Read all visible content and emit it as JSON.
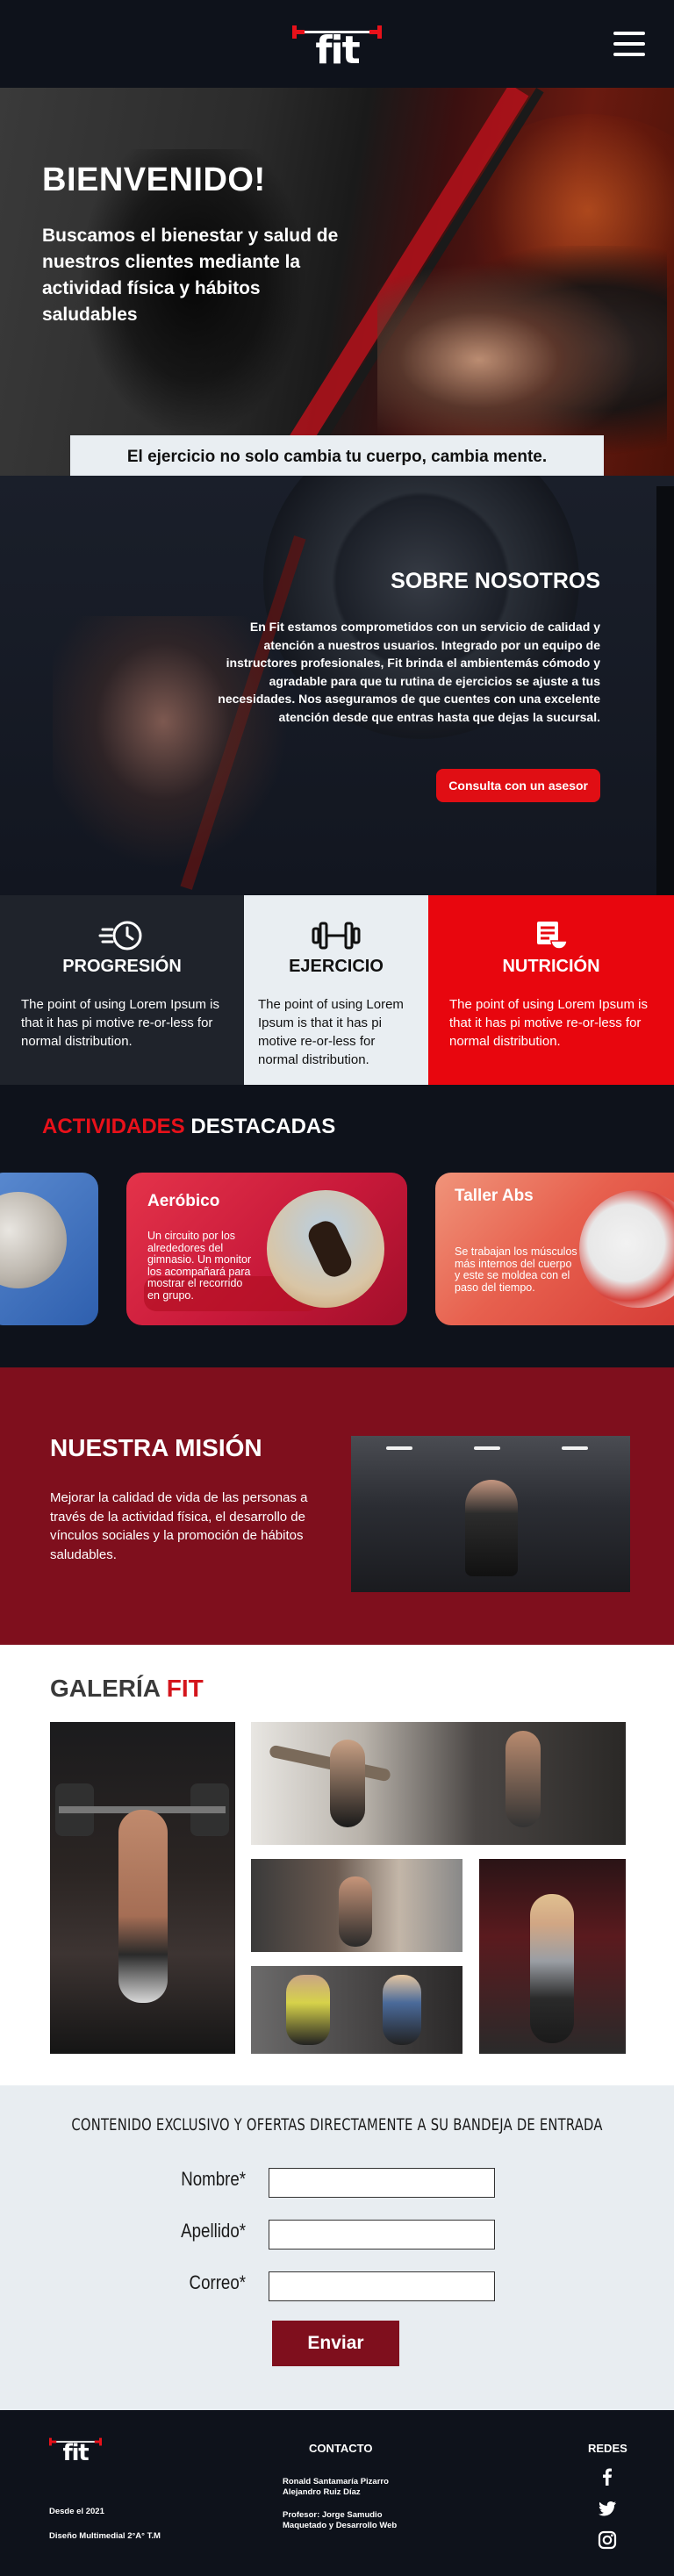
{
  "header": {
    "logo_text": "fit",
    "menu_icon": "hamburger-icon"
  },
  "hero": {
    "title": "BIENVENIDO!",
    "subtitle": "Buscamos el bienestar y salud de nuestros clientes mediante la actividad física y hábitos saludables",
    "banner": "El ejercicio no solo cambia tu cuerpo, cambia mente."
  },
  "about": {
    "title": "SOBRE NOSOTROS",
    "text": "En Fit estamos comprometidos con un servicio de calidad y atención a nuestros usuarios. Integrado por un equipo de instructores profesionales, Fit brinda el ambientemás cómodo y agradable para que tu rutina de ejercicios se ajuste a tus necesidades. Nos aseguramos de que cuentes con una excelente atención desde que entras hasta que dejas la sucursal.",
    "button": "Consulta con un asesor"
  },
  "features": [
    {
      "icon": "timer-icon",
      "title": "PROGRESIÓN",
      "text": "The point of using Lorem Ipsum is that it has pi motive re-or-less for normal distribution."
    },
    {
      "icon": "dumbbell-icon",
      "title": "EJERCICIO",
      "text": "The point of using Lorem Ipsum is that it has pi motive re-or-less for normal distribution."
    },
    {
      "icon": "nutrition-icon",
      "title": "NUTRICIÓN",
      "text": "The point of using Lorem Ipsum is that it has pi motive re-or-less for normal distribution."
    }
  ],
  "activities": {
    "title_highlight": "ACTIVIDADES",
    "title_rest": " DESTACADAS",
    "cards": [
      {
        "title": "Aeróbico",
        "text": "Un circuito por los alrededores del gimnasio. Un monitor los acompañará para mostrar el recorrido en grupo."
      },
      {
        "title": "Taller Abs",
        "text": "Se trabajan los músculos más internos del cuerpo y este se moldea con el paso del tiempo."
      }
    ]
  },
  "mission": {
    "title": "NUESTRA MISIÓN",
    "text": "Mejorar la calidad de vida de las personas a través de la actividad física, el desarrollo de vínculos sociales y la promoción de hábitos saludables."
  },
  "gallery": {
    "title": "GALERÍA",
    "title_highlight": "FIT"
  },
  "newsletter": {
    "title": "CONTENIDO EXCLUSIVO Y OFERTAS DIRECTAMENTE A SU BANDEJA DE ENTRADA",
    "fields": [
      {
        "label": "Nombre*",
        "value": ""
      },
      {
        "label": "Apellido*",
        "value": ""
      },
      {
        "label": "Correo*",
        "value": ""
      }
    ],
    "button": "Enviar"
  },
  "footer": {
    "since": "Desde el 2021",
    "course": "Diseño Multimedial 2°A° T.M",
    "contact_title": "CONTACTO",
    "authors_1": "Ronald Santamaría Pizarro",
    "authors_2": "Alejandro Ruiz Díaz",
    "prof_1": "Profesor: Jorge Samudio",
    "prof_2": "Maquetado y Desarrollo Web",
    "social_title": "REDES",
    "social": [
      "facebook-icon",
      "twitter-icon",
      "instagram-icon"
    ]
  },
  "colors": {
    "brand_red": "#e8111a",
    "mission_bg": "#7f0f1d",
    "dark_bg": "#0e121b",
    "light_bg": "#e8edf1"
  }
}
